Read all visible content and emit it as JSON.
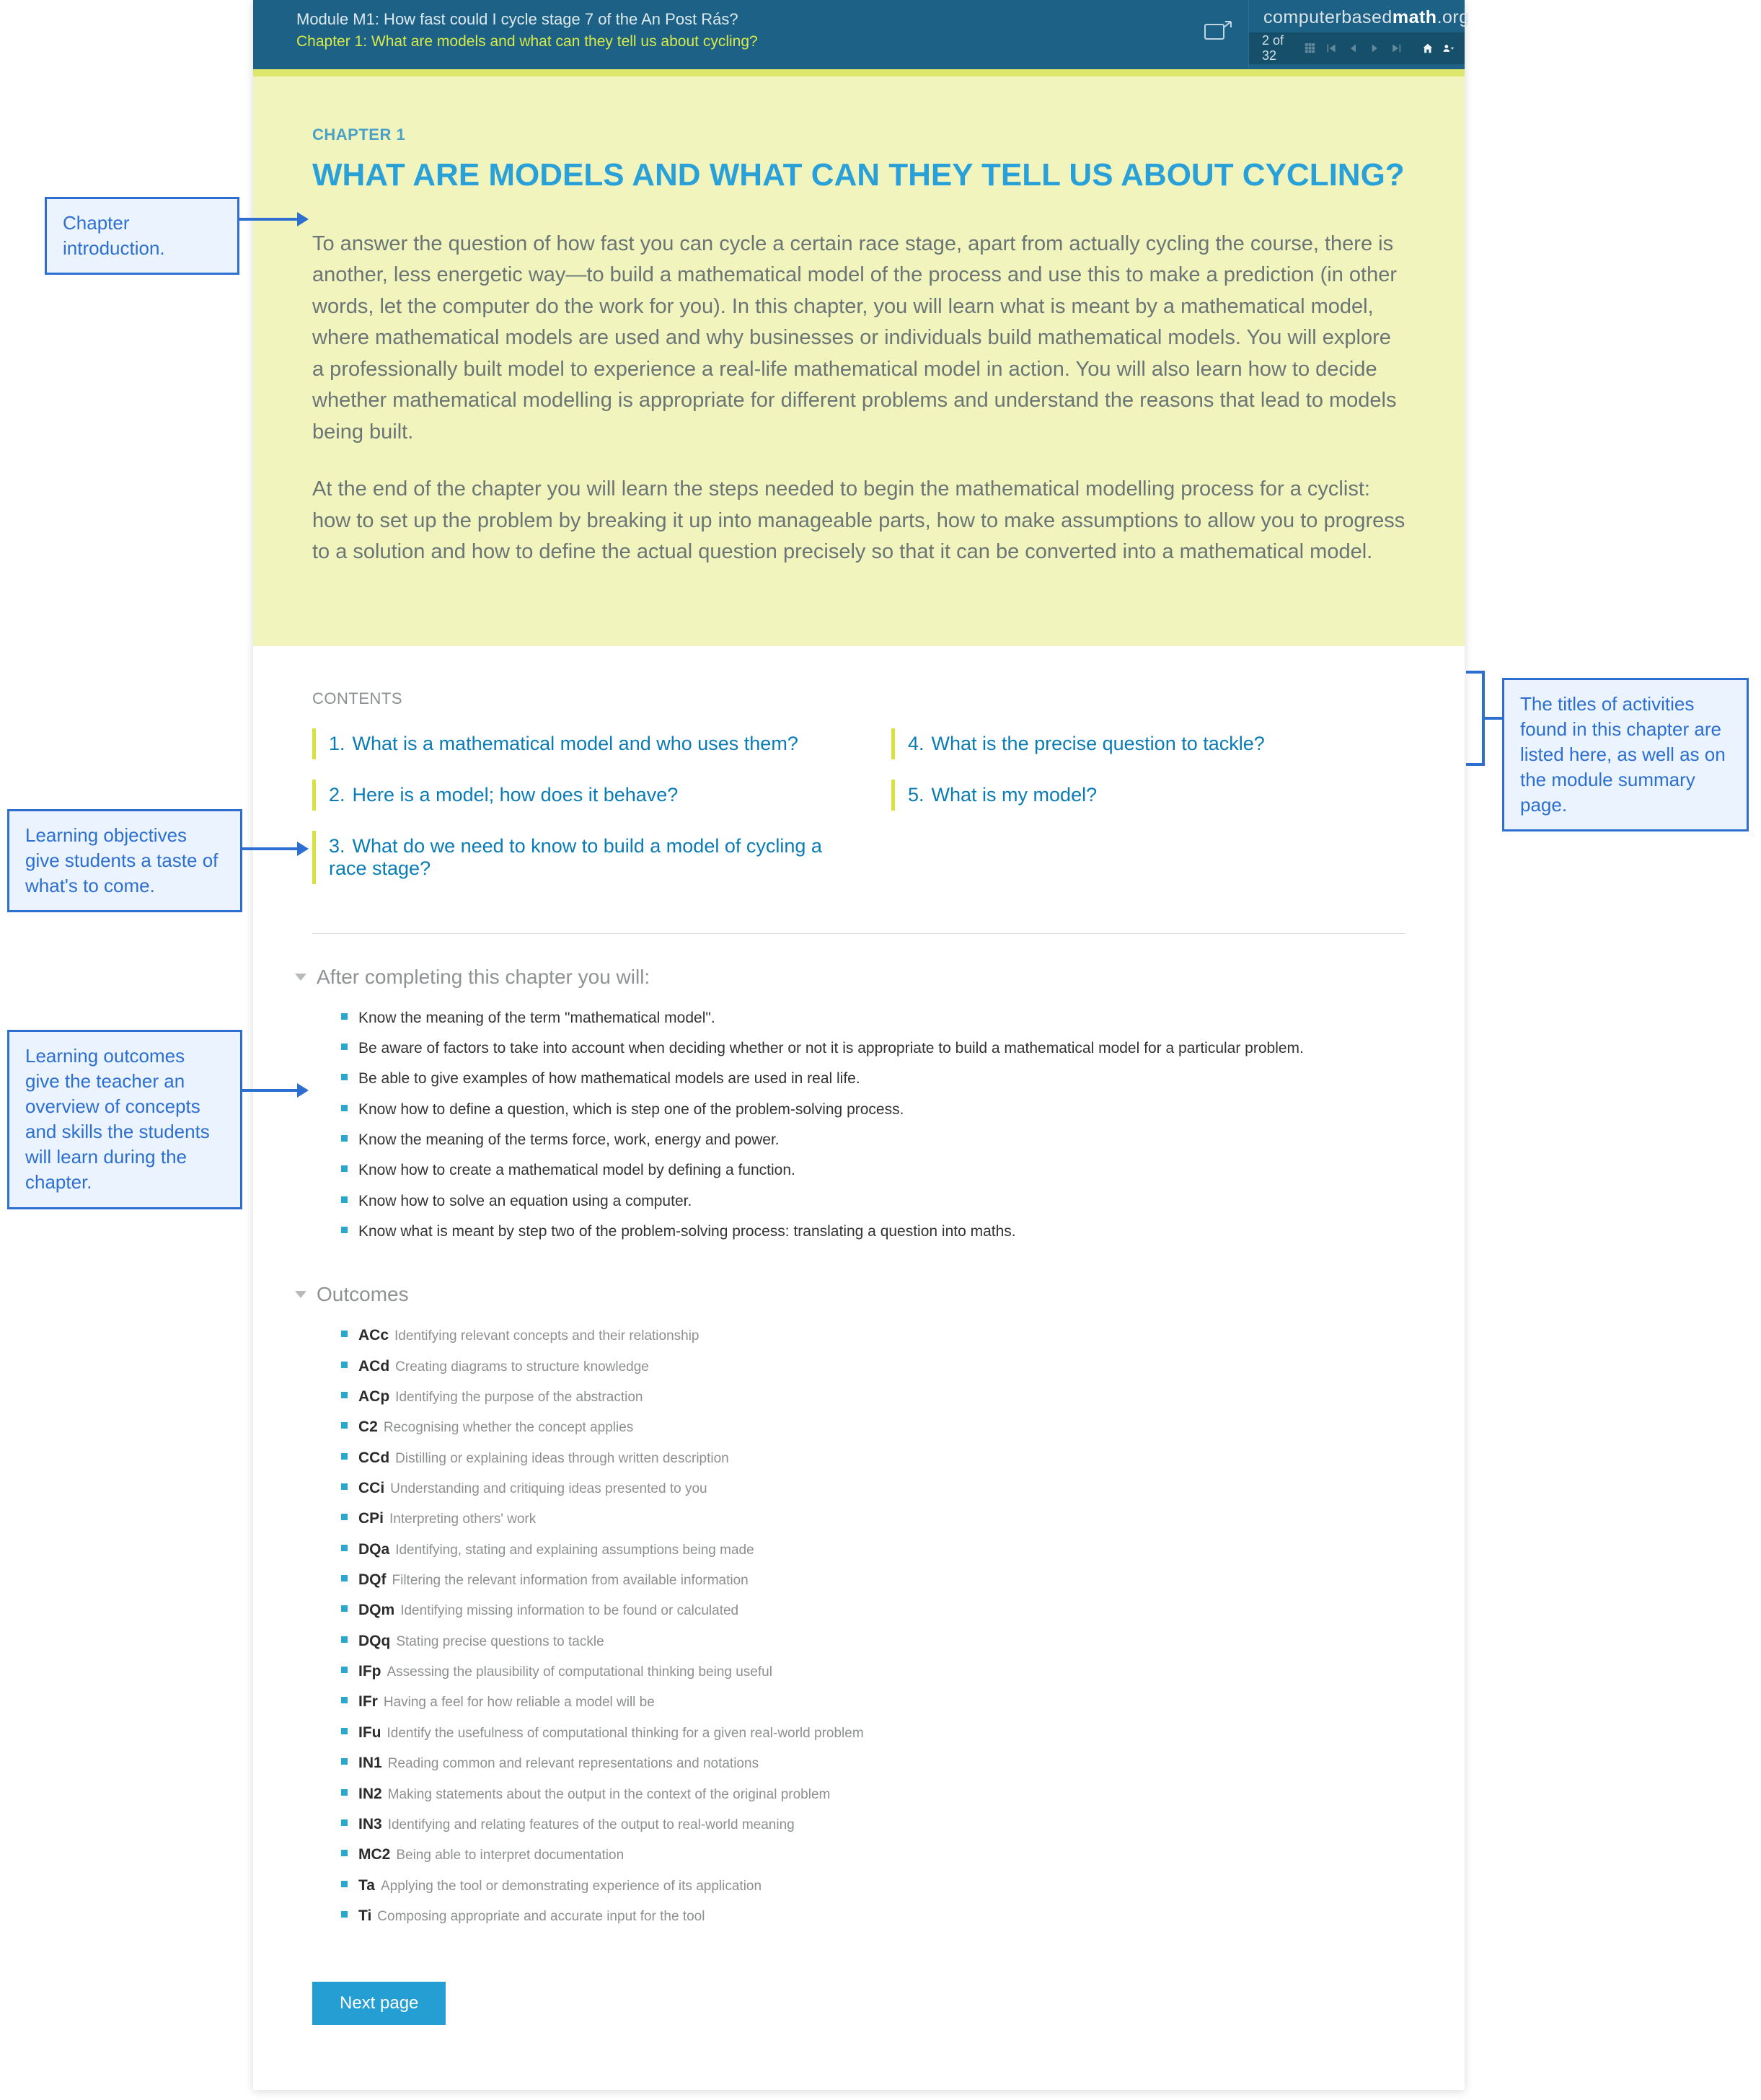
{
  "header": {
    "module_line": "Module M1: How fast could I cycle stage 7 of the An Post Rás?",
    "chapter_line": "Chapter 1: What are models and what can they tell us about cycling?",
    "brand_1": "computer",
    "brand_2": "based",
    "brand_3": "math",
    "brand_4": ".org",
    "page_counter": "2 of 32"
  },
  "intro": {
    "label": "CHAPTER 1",
    "title": "WHAT ARE MODELS AND WHAT CAN THEY TELL US ABOUT CYCLING?",
    "p1": "To answer the question of how fast you can cycle a certain race stage, apart from actually cycling the course, there is another, less energetic way—to build a mathematical model of the process and use this to make a prediction (in other words, let the computer do the work for you). In this chapter, you will learn what is meant by a mathematical model, where mathematical models are used and why businesses or individuals build mathematical models. You will explore a professionally built model to experience a real-life mathematical model in action. You will also learn how to decide whether mathematical modelling is appropriate for different problems and understand the reasons that lead to models being built.",
    "p2": "At the end of the chapter you will learn the steps needed to begin the mathematical modelling process for a cyclist: how to set up the problem by breaking it up into manageable parts, how to make assumptions to allow you to progress to a solution and how to define the actual question precisely so that it can be converted into a mathematical model."
  },
  "contents_heading": "CONTENTS",
  "toc": {
    "left": [
      {
        "num": "1.",
        "title": "What is a mathematical model and who uses them?"
      },
      {
        "num": "2.",
        "title": "Here is a model; how does it behave?"
      },
      {
        "num": "3.",
        "title": "What do we need to know to build a model of cycling a race stage?"
      }
    ],
    "right": [
      {
        "num": "4.",
        "title": "What is the precise question to tackle?"
      },
      {
        "num": "5.",
        "title": "What is my model?"
      }
    ]
  },
  "objectives_heading": "After completing this chapter you will:",
  "objectives": [
    "Know the meaning of the term \"mathematical model\".",
    "Be aware of factors to take into account when deciding whether or not it is appropriate to build a mathematical model for a particular problem.",
    "Be able to give examples of how mathematical models are used in real life.",
    "Know how to define a question, which is step one of the problem-solving process.",
    "Know the meaning of the terms force, work, energy and power.",
    "Know how to create a mathematical model by defining a function.",
    "Know how to solve an equation using a computer.",
    "Know what is meant by step two of the problem-solving process: translating a question into maths."
  ],
  "outcomes_heading": "Outcomes",
  "outcomes": [
    {
      "code": "ACc",
      "desc": "Identifying relevant concepts and their relationship"
    },
    {
      "code": "ACd",
      "desc": "Creating diagrams to structure knowledge"
    },
    {
      "code": "ACp",
      "desc": "Identifying the purpose of the abstraction"
    },
    {
      "code": "C2",
      "desc": "Recognising whether the concept applies"
    },
    {
      "code": "CCd",
      "desc": "Distilling or explaining ideas through written description"
    },
    {
      "code": "CCi",
      "desc": "Understanding and critiquing ideas presented to you"
    },
    {
      "code": "CPi",
      "desc": "Interpreting others' work"
    },
    {
      "code": "DQa",
      "desc": "Identifying, stating and explaining assumptions being made"
    },
    {
      "code": "DQf",
      "desc": "Filtering the relevant information from available information"
    },
    {
      "code": "DQm",
      "desc": "Identifying missing information to be found or calculated"
    },
    {
      "code": "DQq",
      "desc": "Stating precise questions to tackle"
    },
    {
      "code": "IFp",
      "desc": "Assessing the plausibility of computational thinking being useful"
    },
    {
      "code": "IFr",
      "desc": "Having a feel for how reliable a model will be"
    },
    {
      "code": "IFu",
      "desc": "Identify the usefulness of computational thinking for a given real-world problem"
    },
    {
      "code": "IN1",
      "desc": "Reading common and relevant representations and notations"
    },
    {
      "code": "IN2",
      "desc": "Making statements about the output in the context of the original problem"
    },
    {
      "code": "IN3",
      "desc": "Identifying and relating features of the output to real-world meaning"
    },
    {
      "code": "MC2",
      "desc": "Being able to interpret documentation"
    },
    {
      "code": "Ta",
      "desc": "Applying the tool or demonstrating experience of its application"
    },
    {
      "code": "Ti",
      "desc": "Composing appropriate and accurate input for the tool"
    }
  ],
  "next_button": "Next page",
  "callouts": {
    "intro": "Chapter introduction.",
    "objectives": "Learning objectives give students a taste of what's to come.",
    "outcomes": "Learning outcomes give the teacher an overview of concepts and skills the students will learn during the chapter.",
    "toc": "The titles of activities found in this chapter are listed here, as well as on the module summary page."
  }
}
